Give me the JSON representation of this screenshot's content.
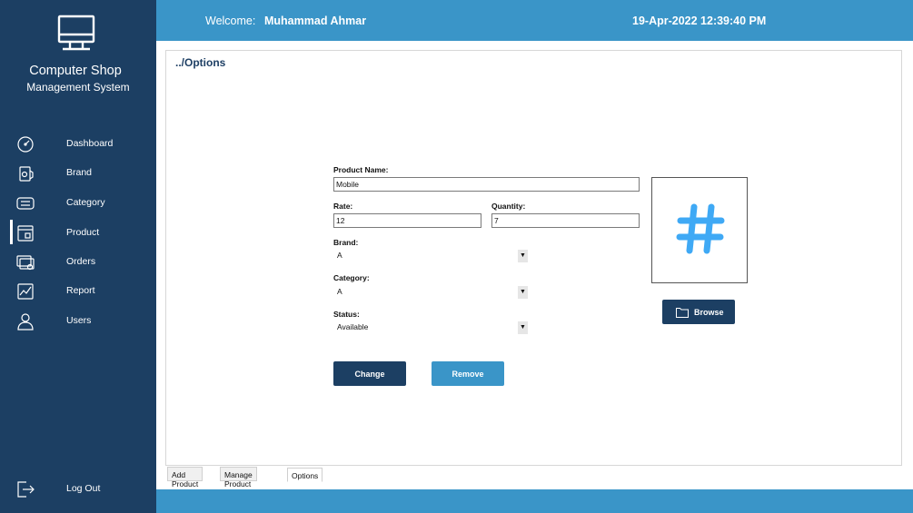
{
  "app": {
    "title": "Computer Shop",
    "subtitle": "Management System"
  },
  "sidebar": {
    "items": [
      {
        "label": "Dashboard",
        "icon": "dashboard-icon"
      },
      {
        "label": "Brand",
        "icon": "brand-icon"
      },
      {
        "label": "Category",
        "icon": "category-icon"
      },
      {
        "label": "Product",
        "icon": "product-icon",
        "active": true
      },
      {
        "label": "Orders",
        "icon": "orders-icon"
      },
      {
        "label": "Report",
        "icon": "report-icon"
      },
      {
        "label": "Users",
        "icon": "users-icon"
      }
    ],
    "logout": "Log Out"
  },
  "header": {
    "welcome_label": "Welcome:",
    "user_name": "Muhammad Ahmar",
    "datetime": "19-Apr-2022 12:39:40 PM"
  },
  "main": {
    "breadcrumb": "../Options",
    "form": {
      "product_name_label": "Product Name:",
      "product_name_value": "Mobile",
      "rate_label": "Rate:",
      "rate_value": "12",
      "quantity_label": "Quantity:",
      "quantity_value": "7",
      "brand_label": "Brand:",
      "brand_value": "A",
      "category_label": "Category:",
      "category_value": "A",
      "status_label": "Status:",
      "status_value": "Available"
    },
    "image_placeholder_icon": "hash-icon",
    "browse_label": "Browse",
    "change_label": "Change",
    "remove_label": "Remove"
  },
  "tabs": [
    {
      "label": "Add Product"
    },
    {
      "label": "Manage Product"
    },
    {
      "label": "Options",
      "active": true
    }
  ],
  "colors": {
    "sidebar": "#1c3f63",
    "accent": "#3a95c8",
    "icon_blue": "#3fa9f5"
  }
}
